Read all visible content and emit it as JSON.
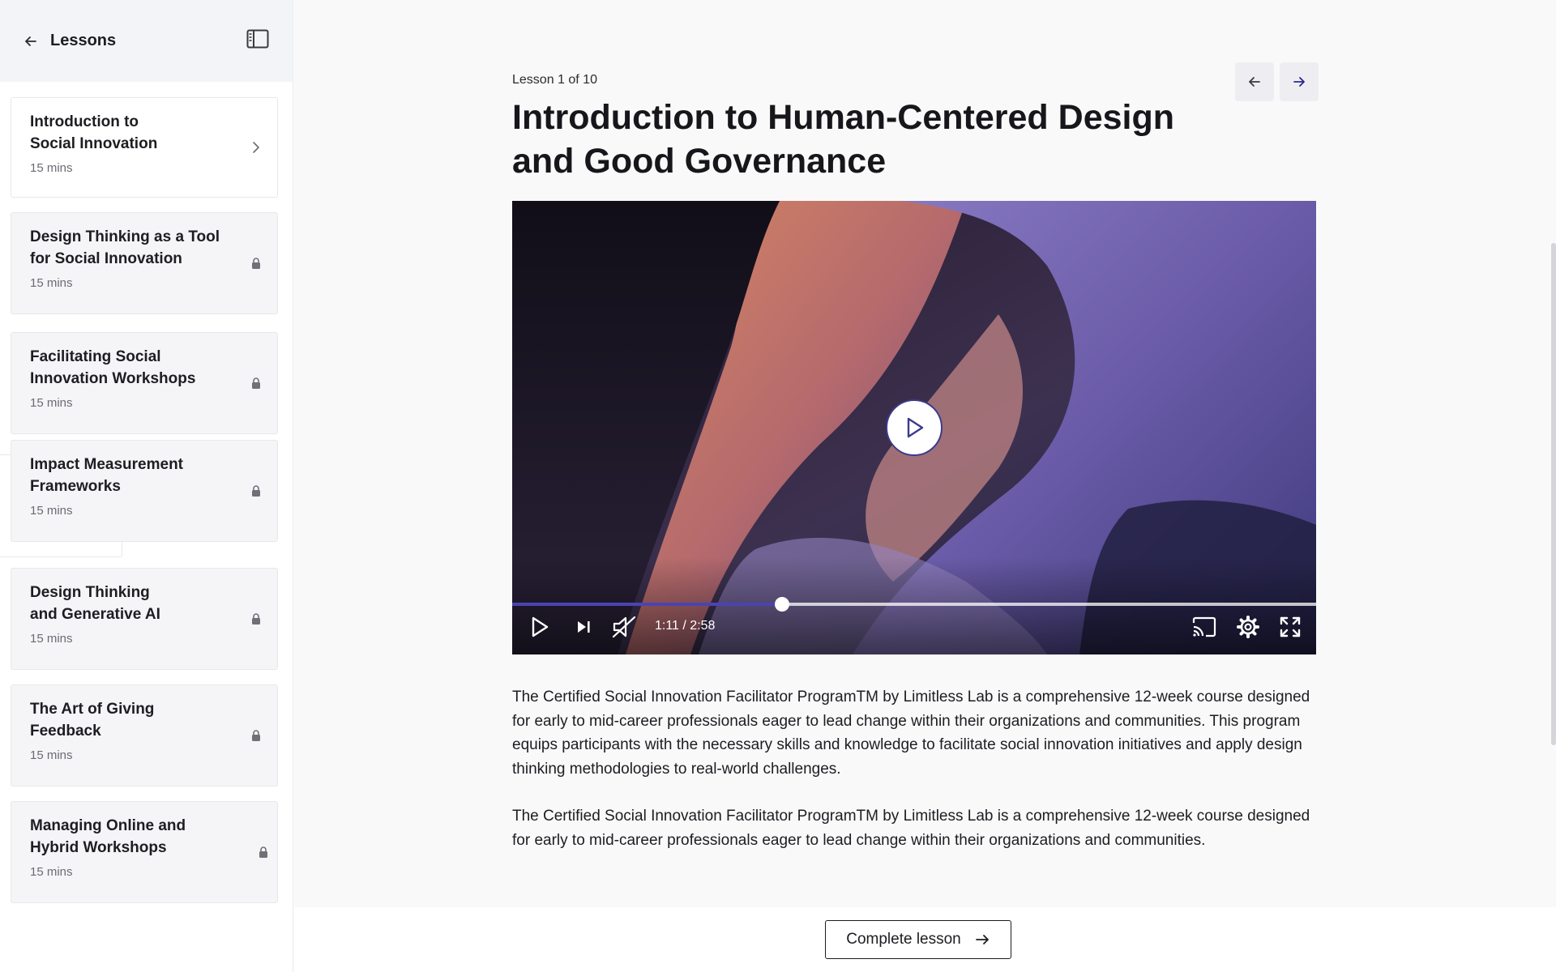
{
  "sidebar": {
    "title": "Lessons",
    "back_icon": "arrow-left-icon",
    "toggle_icon": "sidebar-panel-icon",
    "lessons": [
      {
        "title": "Introduction to\nSocial Innovation",
        "duration": "15 mins",
        "state": "active",
        "icon": "chevron-right-icon"
      },
      {
        "title": "Design Thinking as a Tool for Social Innovation",
        "duration": "15 mins",
        "state": "locked",
        "icon": "lock-icon"
      },
      {
        "title": "Facilitating Social Innovation Workshops",
        "duration": "15 mins",
        "state": "locked",
        "icon": "lock-icon"
      },
      {
        "title": "Impact Measurement Frameworks",
        "duration": "15 mins",
        "state": "locked",
        "icon": "lock-icon"
      },
      {
        "title": "Design Thinking\nand Generative AI",
        "duration": "15 mins",
        "state": "locked",
        "icon": "lock-icon"
      },
      {
        "title": "The Art of Giving Feedback",
        "duration": "15 mins",
        "state": "locked",
        "icon": "lock-icon"
      },
      {
        "title": "Managing Online and Hybrid Workshops",
        "duration": "15 mins",
        "state": "locked",
        "icon": "lock-icon"
      }
    ]
  },
  "main": {
    "lesson_counter": "Lesson 1 of 10",
    "title": "Introduction to Human-Centered Design and Good Governance",
    "nav": {
      "prev_icon": "arrow-left-icon",
      "next_icon": "arrow-right-icon"
    },
    "video": {
      "time": "1:11 / 2:58",
      "progress": 0.336,
      "icons": [
        "play-icon",
        "skip-next-icon",
        "volume-muted-icon",
        "cast-icon",
        "settings-icon",
        "fullscreen-icon"
      ]
    },
    "paragraphs": [
      "The Certified Social Innovation Facilitator ProgramTM by Limitless Lab is a comprehensive 12-week course designed for early to mid-career professionals eager to lead change within their organizations and communities. This program equips participants with the necessary skills and knowledge to facilitate social innovation initiatives and apply design thinking methodologies to real-world challenges.",
      "The Certified Social Innovation Facilitator ProgramTM by Limitless Lab is a comprehensive 12-week course designed for early to mid-career professionals eager to lead change within their organizations and communities."
    ],
    "complete_label": "Complete lesson"
  },
  "colors": {
    "accent": "#4a44b0",
    "play_border": "#3b3a8a",
    "sidebar_header_bg": "#f3f4f7",
    "locked_card_bg": "#f5f5f7"
  }
}
